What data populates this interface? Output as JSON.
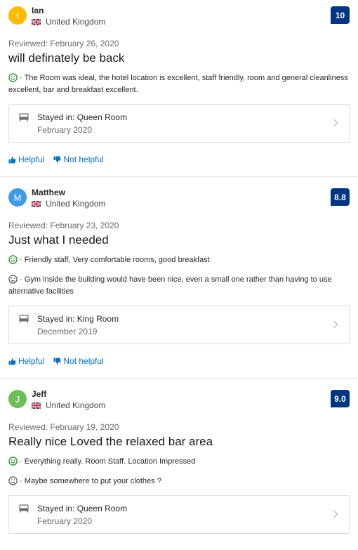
{
  "reviews": [
    {
      "initial": "I",
      "avatar_color": "#febb02",
      "name": "Ian",
      "country": "United Kingdom",
      "score": "10",
      "reviewed": "Reviewed: February 26, 2020",
      "title": "will definately be back",
      "positive": "The Room was ideal, the hotel location is excellent, staff friendly, room and general cleanliness excellent, bar and breakfast excellent.",
      "stayed_label": "Stayed in:",
      "room": "Queen Room",
      "stay_date": "February 2020",
      "helpful": "Helpful",
      "not_helpful": "Not helpful"
    },
    {
      "initial": "M",
      "avatar_color": "#3e9ae6",
      "name": "Matthew",
      "country": "United Kingdom",
      "score": "8.8",
      "reviewed": "Reviewed: February 23, 2020",
      "title": "Just what I needed",
      "positive": "Friendly staff, Very comfortable rooms, good breakfast",
      "negative": "Gym inside the building would have been nice, even a small one rather than having to use alternative facilities",
      "stayed_label": "Stayed in:",
      "room": "King Room",
      "stay_date": "December 2019",
      "helpful": "Helpful",
      "not_helpful": "Not helpful"
    },
    {
      "initial": "J",
      "avatar_color": "#6cbf57",
      "name": "Jeff",
      "country": "United Kingdom",
      "score": "9.0",
      "reviewed": "Reviewed: February 19, 2020",
      "title": "Really nice Loved the relaxed bar area",
      "positive": "Everything really. Room Staff. Location Impressed",
      "negative": "Maybe somewhere to put your clothes ?",
      "stayed_label": "Stayed in:",
      "room": "Queen Room",
      "stay_date": "February 2020"
    }
  ],
  "colors": {
    "score_bg": "#003580",
    "link": "#0071c2",
    "positive_face": "#008009",
    "negative_face": "#474747"
  },
  "icons": {
    "flag": "uk-flag-icon",
    "positive": "smiley-icon",
    "negative": "frown-icon",
    "stay": "bed-icon",
    "open": "chevron-right-icon",
    "helpful": "thumbs-up-icon",
    "not_helpful": "thumbs-down-icon"
  }
}
